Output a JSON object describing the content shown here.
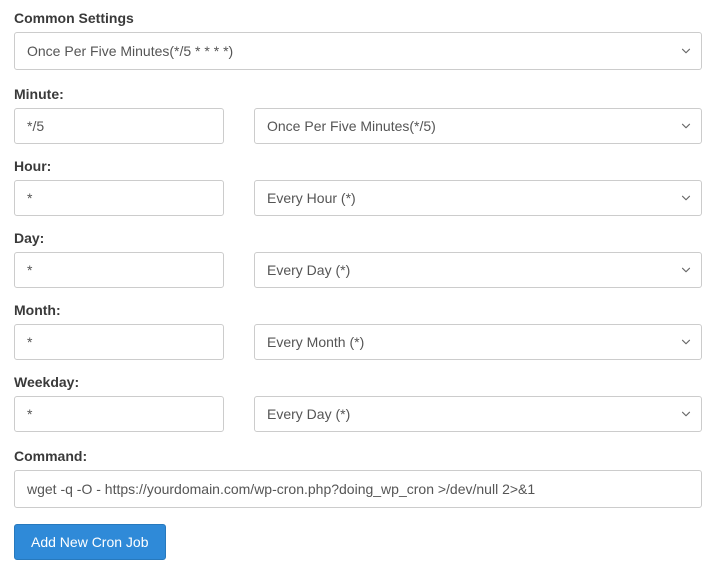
{
  "common": {
    "label": "Common Settings",
    "value": "Once Per Five Minutes(*/5 * * * *)"
  },
  "fields": {
    "minute": {
      "label": "Minute:",
      "input": "*/5",
      "select": "Once Per Five Minutes(*/5)"
    },
    "hour": {
      "label": "Hour:",
      "input": "*",
      "select": "Every Hour (*)"
    },
    "day": {
      "label": "Day:",
      "input": "*",
      "select": "Every Day (*)"
    },
    "month": {
      "label": "Month:",
      "input": "*",
      "select": "Every Month (*)"
    },
    "weekday": {
      "label": "Weekday:",
      "input": "*",
      "select": "Every Day (*)"
    }
  },
  "command": {
    "label": "Command:",
    "value": "wget -q -O - https://yourdomain.com/wp-cron.php?doing_wp_cron >/dev/null 2>&1"
  },
  "submit": {
    "label": "Add New Cron Job"
  }
}
